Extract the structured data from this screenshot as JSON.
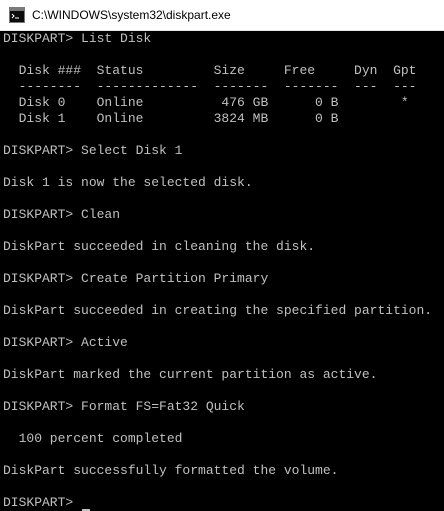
{
  "window": {
    "title": "C:\\WINDOWS\\system32\\diskpart.exe",
    "icon": "console-app-icon"
  },
  "console": {
    "lines": [
      "DISKPART> List Disk",
      "",
      "  Disk ###  Status         Size     Free     Dyn  Gpt",
      "  --------  -------------  -------  -------  ---  ---",
      "  Disk 0    Online          476 GB      0 B        *",
      "  Disk 1    Online         3824 MB      0 B",
      "",
      "DISKPART> Select Disk 1",
      "",
      "Disk 1 is now the selected disk.",
      "",
      "DISKPART> Clean",
      "",
      "DiskPart succeeded in cleaning the disk.",
      "",
      "DISKPART> Create Partition Primary",
      "",
      "DiskPart succeeded in creating the specified partition.",
      "",
      "DISKPART> Active",
      "",
      "DiskPart marked the current partition as active.",
      "",
      "DISKPART> Format FS=Fat32 Quick",
      "",
      "  100 percent completed",
      "",
      "DiskPart successfully formatted the volume.",
      "",
      "DISKPART> "
    ]
  }
}
